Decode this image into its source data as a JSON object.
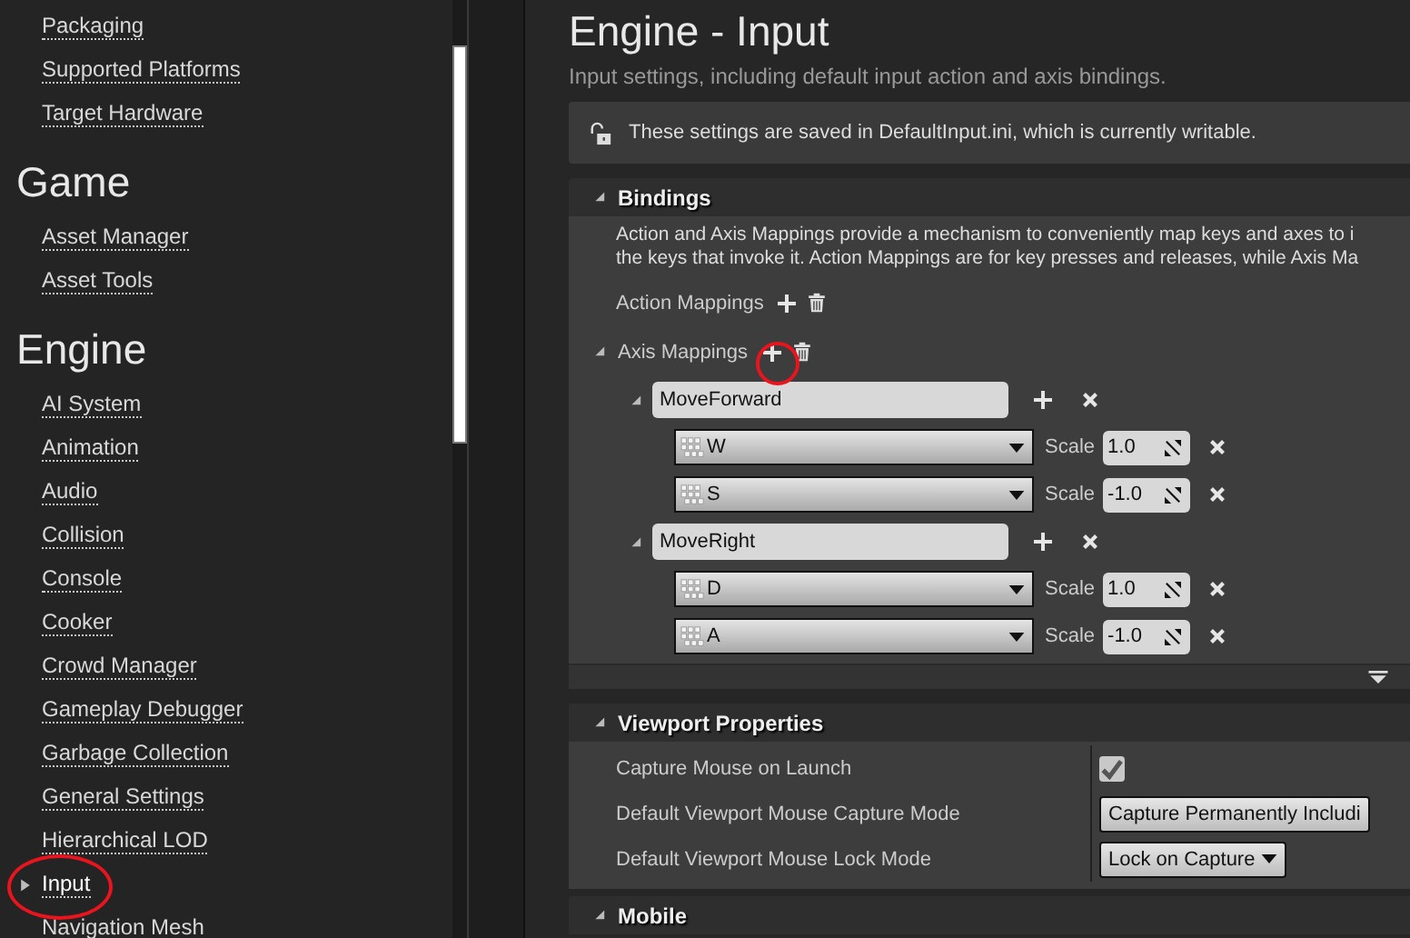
{
  "sidebar": {
    "sections": [
      {
        "items": [
          {
            "label": "Packaging",
            "selected": false
          },
          {
            "label": "Supported Platforms",
            "selected": false
          },
          {
            "label": "Target Hardware",
            "selected": false
          }
        ]
      },
      {
        "heading": "Game",
        "items": [
          {
            "label": "Asset Manager",
            "selected": false
          },
          {
            "label": "Asset Tools",
            "selected": false
          }
        ]
      },
      {
        "heading": "Engine",
        "items": [
          {
            "label": "AI System",
            "selected": false
          },
          {
            "label": "Animation",
            "selected": false
          },
          {
            "label": "Audio",
            "selected": false
          },
          {
            "label": "Collision",
            "selected": false
          },
          {
            "label": "Console",
            "selected": false
          },
          {
            "label": "Cooker",
            "selected": false
          },
          {
            "label": "Crowd Manager",
            "selected": false
          },
          {
            "label": "Gameplay Debugger",
            "selected": false
          },
          {
            "label": "Garbage Collection",
            "selected": false
          },
          {
            "label": "General Settings",
            "selected": false
          },
          {
            "label": "Hierarchical LOD",
            "selected": false
          },
          {
            "label": "Input",
            "selected": true
          },
          {
            "label": "Navigation Mesh",
            "selected": false
          }
        ]
      }
    ]
  },
  "page": {
    "title": "Engine - Input",
    "description": "Input settings, including default input action and axis bindings.",
    "notice": "These settings are saved in DefaultInput.ini, which is currently writable."
  },
  "bindings": {
    "title": "Bindings",
    "expanded": true,
    "description": [
      "Action and Axis Mappings provide a mechanism to conveniently map keys and axes to i",
      "the keys that invoke it. Action Mappings are for key presses and releases, while Axis Ma"
    ],
    "action_mappings": {
      "label": "Action Mappings"
    },
    "axis_mappings": {
      "label": "Axis Mappings",
      "expanded": true,
      "mappings": [
        {
          "name": "MoveForward",
          "expanded": true,
          "keys": [
            {
              "key": "W",
              "scale_label": "Scale",
              "scale": "1.0"
            },
            {
              "key": "S",
              "scale_label": "Scale",
              "scale": "-1.0"
            }
          ]
        },
        {
          "name": "MoveRight",
          "expanded": true,
          "keys": [
            {
              "key": "D",
              "scale_label": "Scale",
              "scale": "1.0"
            },
            {
              "key": "A",
              "scale_label": "Scale",
              "scale": "-1.0"
            }
          ]
        }
      ]
    }
  },
  "viewport": {
    "title": "Viewport Properties",
    "expanded": true,
    "rows": [
      {
        "kind": "checkbox",
        "label": "Capture Mouse on Launch",
        "checked": true
      },
      {
        "kind": "combo",
        "label": "Default Viewport Mouse Capture Mode",
        "value": "Capture Permanently Includi"
      },
      {
        "kind": "dropdown",
        "label": "Default Viewport Mouse Lock Mode",
        "value": "Lock on Capture"
      }
    ]
  },
  "mobile": {
    "title": "Mobile",
    "expanded": true
  }
}
